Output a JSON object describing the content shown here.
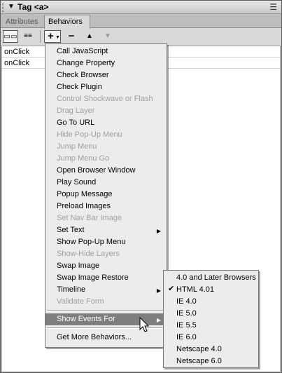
{
  "panel": {
    "title": "Tag <a>",
    "collapse_icon": "triangle-down-icon",
    "options_icon": "panel-options-icon"
  },
  "tabs": [
    {
      "label": "Attributes",
      "active": false
    },
    {
      "label": "Behaviors",
      "active": true
    }
  ],
  "toolbar": {
    "add_label": "+",
    "remove_label": "−",
    "up_label": "▲",
    "down_label": "▼"
  },
  "events": [
    {
      "event": "onClick"
    },
    {
      "event": "onClick"
    }
  ],
  "menu": {
    "items": [
      {
        "label": "Call JavaScript",
        "disabled": false
      },
      {
        "label": "Change Property",
        "disabled": false
      },
      {
        "label": "Check Browser",
        "disabled": false
      },
      {
        "label": "Check Plugin",
        "disabled": false
      },
      {
        "label": "Control Shockwave or Flash",
        "disabled": true
      },
      {
        "label": "Drag Layer",
        "disabled": true
      },
      {
        "label": "Go To URL",
        "disabled": false
      },
      {
        "label": "Hide Pop-Up Menu",
        "disabled": true
      },
      {
        "label": "Jump Menu",
        "disabled": true
      },
      {
        "label": "Jump Menu Go",
        "disabled": true
      },
      {
        "label": "Open Browser Window",
        "disabled": false
      },
      {
        "label": "Play Sound",
        "disabled": false
      },
      {
        "label": "Popup Message",
        "disabled": false
      },
      {
        "label": "Preload Images",
        "disabled": false
      },
      {
        "label": "Set Nav Bar Image",
        "disabled": true
      },
      {
        "label": "Set Text",
        "disabled": false,
        "submenu": true
      },
      {
        "label": "Show Pop-Up Menu",
        "disabled": false
      },
      {
        "label": "Show-Hide Layers",
        "disabled": true
      },
      {
        "label": "Swap Image",
        "disabled": false
      },
      {
        "label": "Swap Image Restore",
        "disabled": false
      },
      {
        "label": "Timeline",
        "disabled": false,
        "submenu": true
      },
      {
        "label": "Validate Form",
        "disabled": true
      }
    ],
    "show_events": "Show Events For",
    "more": "Get More Behaviors..."
  },
  "submenu": {
    "items": [
      {
        "label": "4.0 and Later Browsers",
        "checked": false
      },
      {
        "label": "HTML 4.01",
        "checked": true
      },
      {
        "label": "IE 4.0",
        "checked": false
      },
      {
        "label": "IE 5.0",
        "checked": false
      },
      {
        "label": "IE 5.5",
        "checked": false
      },
      {
        "label": "IE 6.0",
        "checked": false
      },
      {
        "label": "Netscape 4.0",
        "checked": false
      },
      {
        "label": "Netscape 6.0",
        "checked": false
      }
    ]
  },
  "colors": {
    "menu_highlight": "#7e7e7e",
    "disabled_text": "#a0a0a0"
  }
}
